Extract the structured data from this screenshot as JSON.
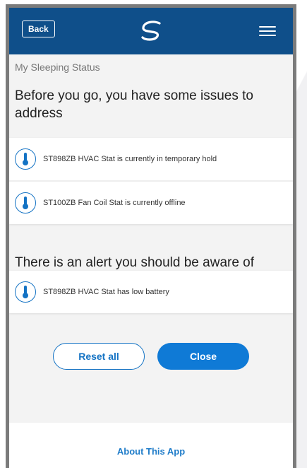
{
  "header": {
    "back_label": "Back",
    "logo_icon": "swirl-logo-icon",
    "menu_icon": "hamburger-menu-icon",
    "bar_color": "#0f4f8a"
  },
  "page": {
    "breadcrumb": "My Sleeping Status",
    "issues_heading": "Before you go, you have some issues to address",
    "alert_heading": "There is an alert you should be aware of"
  },
  "issues": [
    {
      "icon": "thermometer-icon",
      "text": "ST898ZB HVAC Stat is currently in temporary hold"
    },
    {
      "icon": "thermometer-icon",
      "text": "ST100ZB Fan Coil Stat is currently offline"
    }
  ],
  "alerts": [
    {
      "icon": "thermometer-icon",
      "text": "ST898ZB HVAC Stat has low battery"
    }
  ],
  "actions": {
    "reset_label": "Reset all",
    "close_label": "Close",
    "accent": "#0f7ad6"
  },
  "footer": {
    "about_label": "About This App"
  }
}
